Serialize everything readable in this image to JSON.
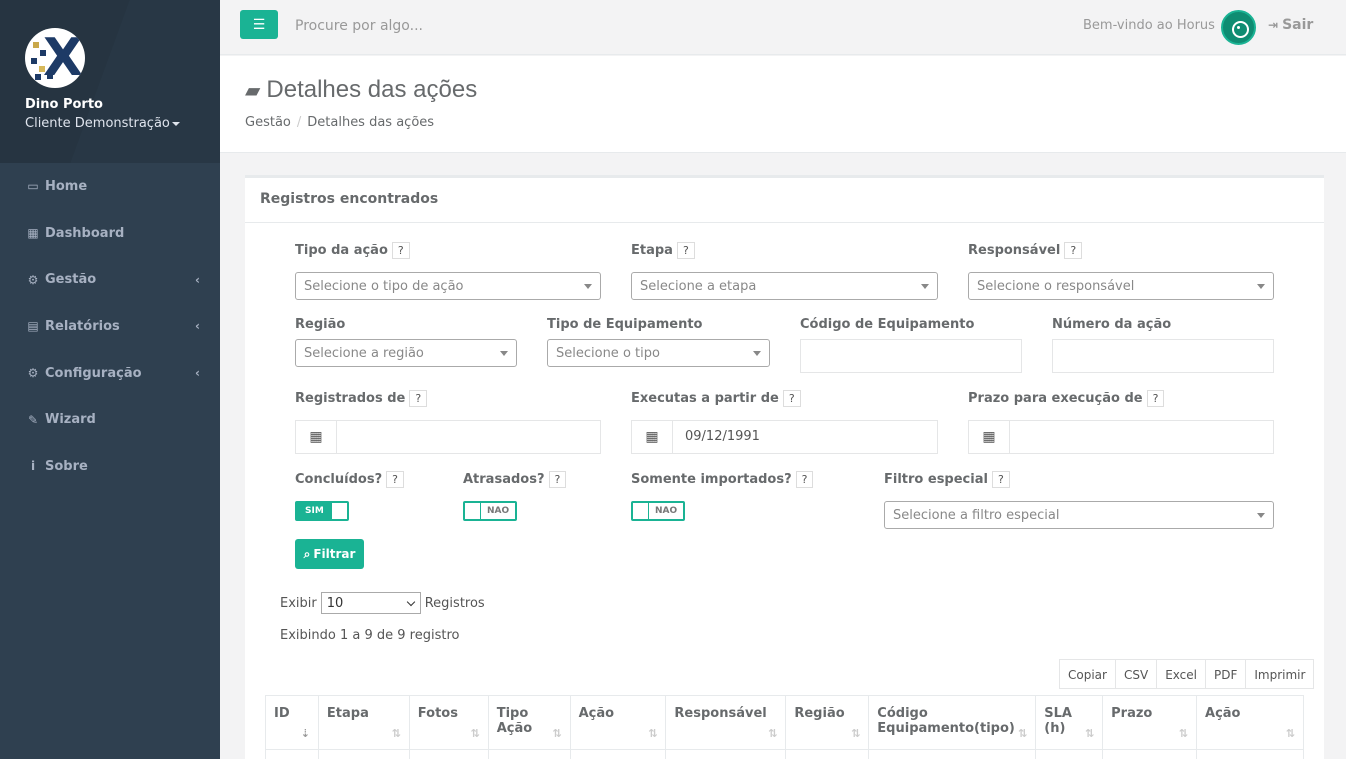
{
  "sidebar": {
    "user_name": "Dino Porto",
    "client": "Cliente Demonstração",
    "items": [
      {
        "label": "Home",
        "icon": "monitor-icon"
      },
      {
        "label": "Dashboard",
        "icon": "grid-icon"
      },
      {
        "label": "Gestão",
        "icon": "cogs-icon"
      },
      {
        "label": "Relatórios",
        "icon": "list-icon"
      },
      {
        "label": "Configuração",
        "icon": "gears-icon"
      },
      {
        "label": "Wizard",
        "icon": "wand-icon"
      },
      {
        "label": "Sobre",
        "icon": "info-icon"
      }
    ]
  },
  "topbar": {
    "search_placeholder": "Procure por algo...",
    "welcome": "Bem-vindo ao Horus",
    "logout": "Sair"
  },
  "page": {
    "title": "Detalhes das ações",
    "breadcrumb": [
      "Gestão",
      "Detalhes das ações"
    ]
  },
  "panel": {
    "title": "Registros encontrados",
    "help": "?",
    "fields": {
      "tipo_acao": {
        "label": "Tipo da ação",
        "placeholder": "Selecione o tipo de ação"
      },
      "etapa": {
        "label": "Etapa",
        "placeholder": "Selecione a etapa"
      },
      "responsavel": {
        "label": "Responsável",
        "placeholder": "Selecione o responsável"
      },
      "regiao": {
        "label": "Região",
        "placeholder": "Selecione a região"
      },
      "tipo_equip": {
        "label": "Tipo de Equipamento",
        "placeholder": "Selecione o tipo"
      },
      "codigo_equip": {
        "label": "Código de Equipamento",
        "value": ""
      },
      "numero_acao": {
        "label": "Número da ação",
        "value": ""
      },
      "registrados": {
        "label": "Registrados de",
        "value": ""
      },
      "executas": {
        "label": "Executas a partir de",
        "value": "09/12/1991"
      },
      "prazo": {
        "label": "Prazo para execução de",
        "value": ""
      },
      "concluidos": {
        "label": "Concluídos?",
        "value": "SIM"
      },
      "atrasados": {
        "label": "Atrasados?",
        "value": "NAO"
      },
      "importados": {
        "label": "Somente importados?",
        "value": "NAO"
      },
      "filtro_especial": {
        "label": "Filtro especial",
        "placeholder": "Selecione a filtro especial"
      }
    },
    "filter_button": "Filtrar",
    "show_label": "Exibir",
    "page_length": "10",
    "records_label": "Registros",
    "info": "Exibindo 1 a 9 de 9 registro",
    "export_buttons": [
      "Copiar",
      "CSV",
      "Excel",
      "PDF",
      "Imprimir"
    ],
    "columns": [
      {
        "line1": "ID",
        "line2": ""
      },
      {
        "line1": "Etapa",
        "line2": ""
      },
      {
        "line1": "Fotos",
        "line2": ""
      },
      {
        "line1": "Tipo",
        "line2": "Ação"
      },
      {
        "line1": "Ação",
        "line2": ""
      },
      {
        "line1": "Responsável",
        "line2": ""
      },
      {
        "line1": "Região",
        "line2": ""
      },
      {
        "line1": "Código",
        "line2": "Equipamento(tipo)"
      },
      {
        "line1": "SLA",
        "line2": "(h)"
      },
      {
        "line1": "Prazo",
        "line2": ""
      },
      {
        "line1": "Ação",
        "line2": ""
      }
    ]
  },
  "colors": {
    "accent": "#1ab394",
    "sidebar": "#2f4050"
  }
}
